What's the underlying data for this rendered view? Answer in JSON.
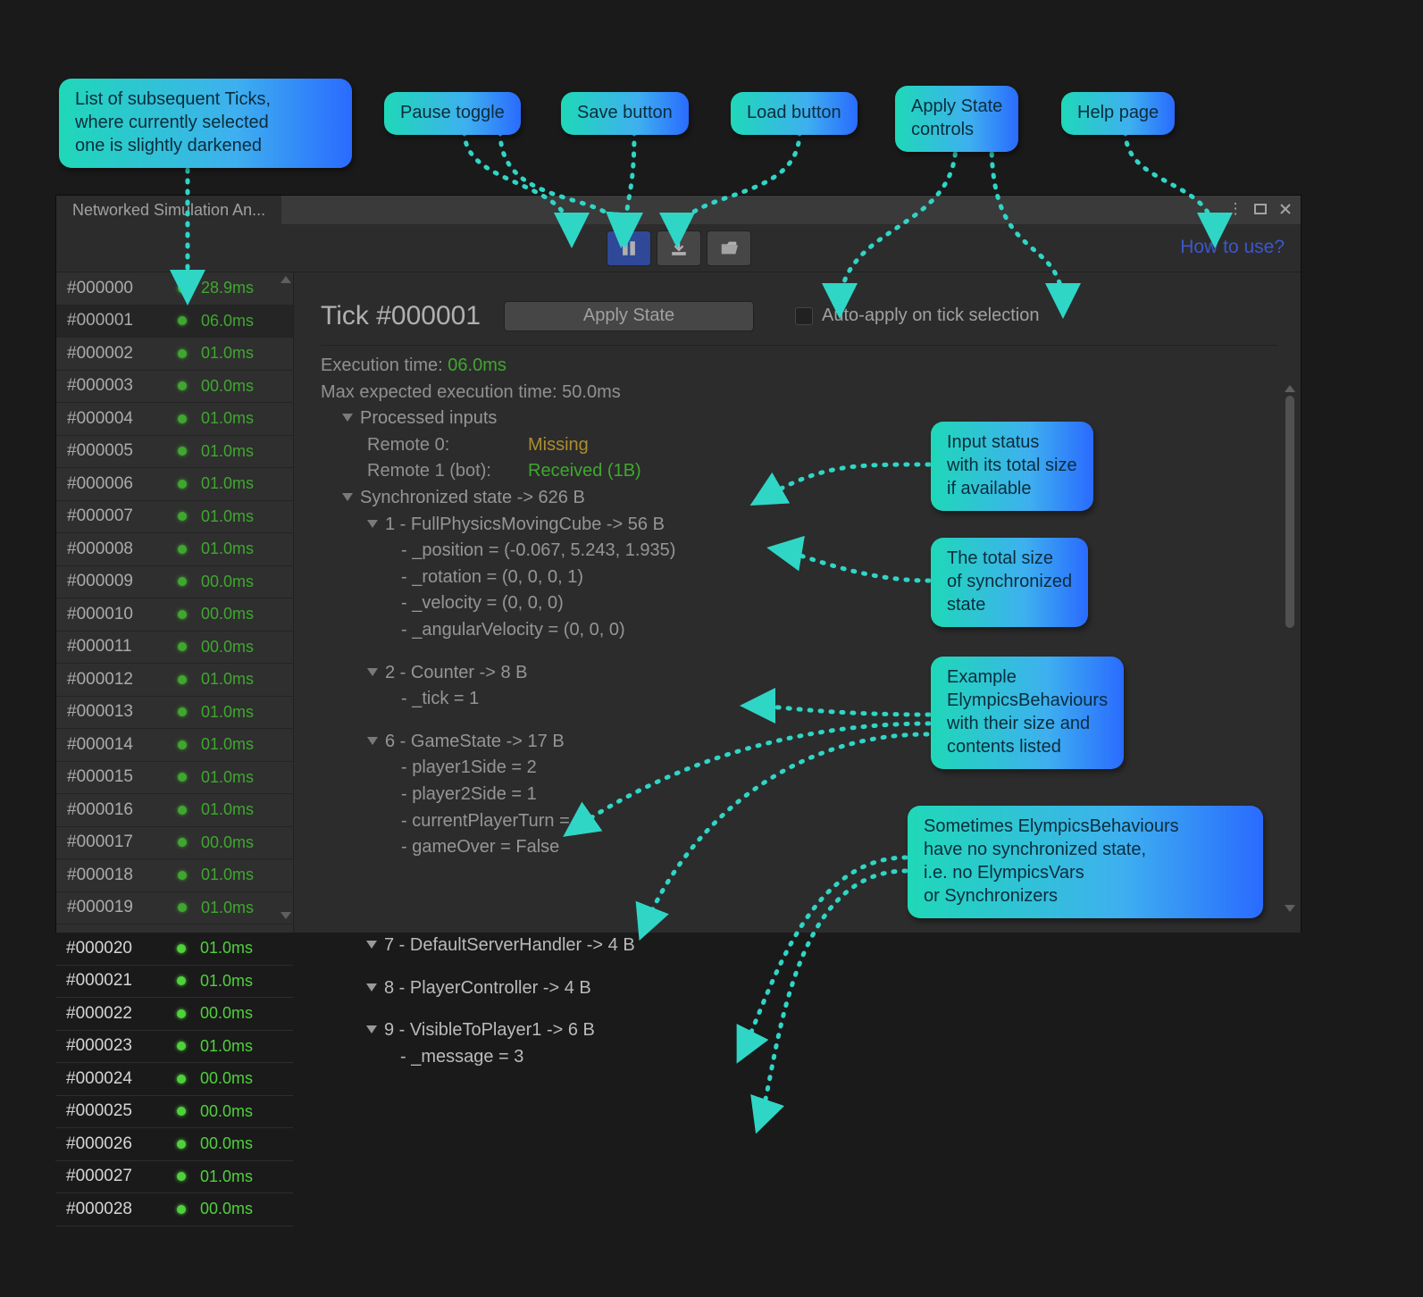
{
  "callouts": {
    "ticklist": "List of subsequent Ticks,\nwhere currently selected\none is slightly darkened",
    "pause": "Pause toggle",
    "save": "Save button",
    "load": "Load button",
    "apply": "Apply State\ncontrols",
    "help": "Help page",
    "inputs": "Input status\nwith its total size\nif available",
    "sync": "The total size\nof synchronized\nstate",
    "behaviours": "Example\nElympicsBehaviours\nwith their size and\ncontents listed",
    "nostate": "Sometimes ElympicsBehaviours\nhave no synchronized state,\ni.e. no ElympicsVars\nor Synchronizers"
  },
  "window": {
    "tab_title": "Networked Simulation An...",
    "how_to_use": "How to use?"
  },
  "tick_header": {
    "title": "Tick #000001",
    "apply_button": "Apply State",
    "auto_apply": "Auto-apply on tick selection"
  },
  "exec": {
    "label": "Execution time:",
    "value": "06.0ms",
    "max_label": "Max expected execution time: 50.0ms"
  },
  "inputs_section": {
    "heading": "Processed inputs",
    "rows": [
      {
        "label": "Remote 0:",
        "status": "Missing",
        "cls": "yellow"
      },
      {
        "label": "Remote 1 (bot):",
        "status": "Received (1B)",
        "cls": "green"
      }
    ]
  },
  "sync_heading": "Synchronized state -> 626 B",
  "nodes": [
    {
      "title": "1 - FullPhysicsMovingCube -> 56 B",
      "fields": [
        "- _position = (-0.067, 5.243, 1.935)",
        "- _rotation = (0, 0, 0, 1)",
        "- _velocity = (0, 0, 0)",
        "- _angularVelocity = (0, 0, 0)"
      ]
    },
    {
      "title": "2 - Counter -> 8 B",
      "fields": [
        "- _tick = 1"
      ]
    },
    {
      "title": "6 - GameState -> 17 B",
      "fields": [
        "- player1Side = 2",
        "- player2Side = 1",
        "- currentPlayerTurn = 0",
        "- gameOver = False"
      ]
    },
    {
      "title": "7 - DefaultServerHandler -> 4 B",
      "fields": []
    },
    {
      "title": "8 - PlayerController -> 4 B",
      "fields": []
    },
    {
      "title": "9 - VisibleToPlayer1 -> 6 B",
      "fields": [
        "- _message = 3"
      ]
    }
  ],
  "ticks": [
    {
      "id": "#000000",
      "ms": "28.9ms"
    },
    {
      "id": "#000001",
      "ms": "06.0ms",
      "sel": true
    },
    {
      "id": "#000002",
      "ms": "01.0ms"
    },
    {
      "id": "#000003",
      "ms": "00.0ms"
    },
    {
      "id": "#000004",
      "ms": "01.0ms"
    },
    {
      "id": "#000005",
      "ms": "01.0ms"
    },
    {
      "id": "#000006",
      "ms": "01.0ms"
    },
    {
      "id": "#000007",
      "ms": "01.0ms"
    },
    {
      "id": "#000008",
      "ms": "01.0ms"
    },
    {
      "id": "#000009",
      "ms": "00.0ms"
    },
    {
      "id": "#000010",
      "ms": "00.0ms"
    },
    {
      "id": "#000011",
      "ms": "00.0ms"
    },
    {
      "id": "#000012",
      "ms": "01.0ms"
    },
    {
      "id": "#000013",
      "ms": "01.0ms"
    },
    {
      "id": "#000014",
      "ms": "01.0ms"
    },
    {
      "id": "#000015",
      "ms": "01.0ms"
    },
    {
      "id": "#000016",
      "ms": "01.0ms"
    },
    {
      "id": "#000017",
      "ms": "00.0ms"
    },
    {
      "id": "#000018",
      "ms": "01.0ms"
    },
    {
      "id": "#000019",
      "ms": "01.0ms"
    },
    {
      "id": "#000020",
      "ms": "01.0ms"
    },
    {
      "id": "#000021",
      "ms": "01.0ms"
    },
    {
      "id": "#000022",
      "ms": "00.0ms"
    },
    {
      "id": "#000023",
      "ms": "01.0ms"
    },
    {
      "id": "#000024",
      "ms": "00.0ms"
    },
    {
      "id": "#000025",
      "ms": "00.0ms"
    },
    {
      "id": "#000026",
      "ms": "00.0ms"
    },
    {
      "id": "#000027",
      "ms": "01.0ms"
    },
    {
      "id": "#000028",
      "ms": "00.0ms"
    }
  ]
}
